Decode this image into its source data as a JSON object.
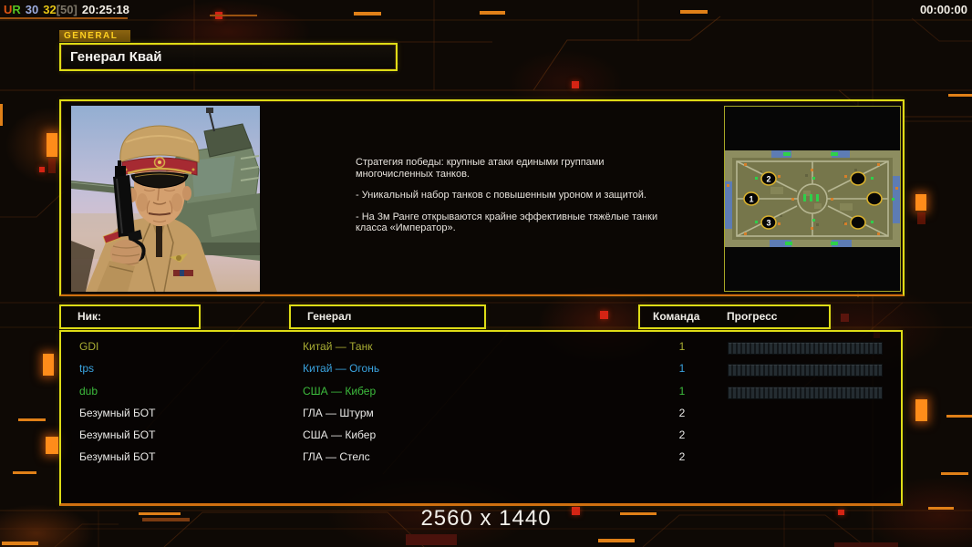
{
  "statusbar": {
    "u": "U",
    "r": "R",
    "n1": "30",
    "n2": "32",
    "n3": "[50]",
    "clock": "20:25:18",
    "timer": "00:00:00"
  },
  "header": {
    "tab": "GENERAL",
    "title": "Генерал Квай"
  },
  "info": {
    "p1": "Стратегия победы: крупные атаки едиными группами\n многочисленных танков.",
    "p2": "- Уникальный набор танков с повышенным уроном и защитой.",
    "p3": "- На 3м Ранге открываются крайне эффективные тяжёлые танки\n класса «Император»."
  },
  "minimap": {
    "spawn_top": "2",
    "spawn_mid": "1",
    "spawn_bottom": "3"
  },
  "roster": {
    "header_nick": "Ник:",
    "header_general": "Генерал",
    "header_team": "Команда",
    "header_progress": "Прогресс",
    "rows": [
      {
        "nick": "GDI",
        "general": "Китай — Танк",
        "team": "1",
        "color": "#a9ad33",
        "loading": true
      },
      {
        "nick": "tps",
        "general": "Китай — Огонь",
        "team": "1",
        "color": "#3aa4e0",
        "loading": true
      },
      {
        "nick": "dub",
        "general": "США — Кибер",
        "team": "1",
        "color": "#3dbc3d",
        "loading": true
      },
      {
        "nick": "Безумный БОТ",
        "general": "ГЛА — Штурм",
        "team": "2",
        "color": "#e8e8e6",
        "loading": false
      },
      {
        "nick": "Безумный БОТ",
        "general": "США — Кибер",
        "team": "2",
        "color": "#e8e8e6",
        "loading": false
      },
      {
        "nick": "Безумный БОТ",
        "general": "ГЛА — Стелс",
        "team": "2",
        "color": "#e8e8e6",
        "loading": false
      }
    ]
  },
  "footer": {
    "resolution": "2560 x 1440"
  },
  "colors": {
    "border_yellow": "#dedc16",
    "accent_orange": "#e07818",
    "tab_text": "#ffd020"
  }
}
